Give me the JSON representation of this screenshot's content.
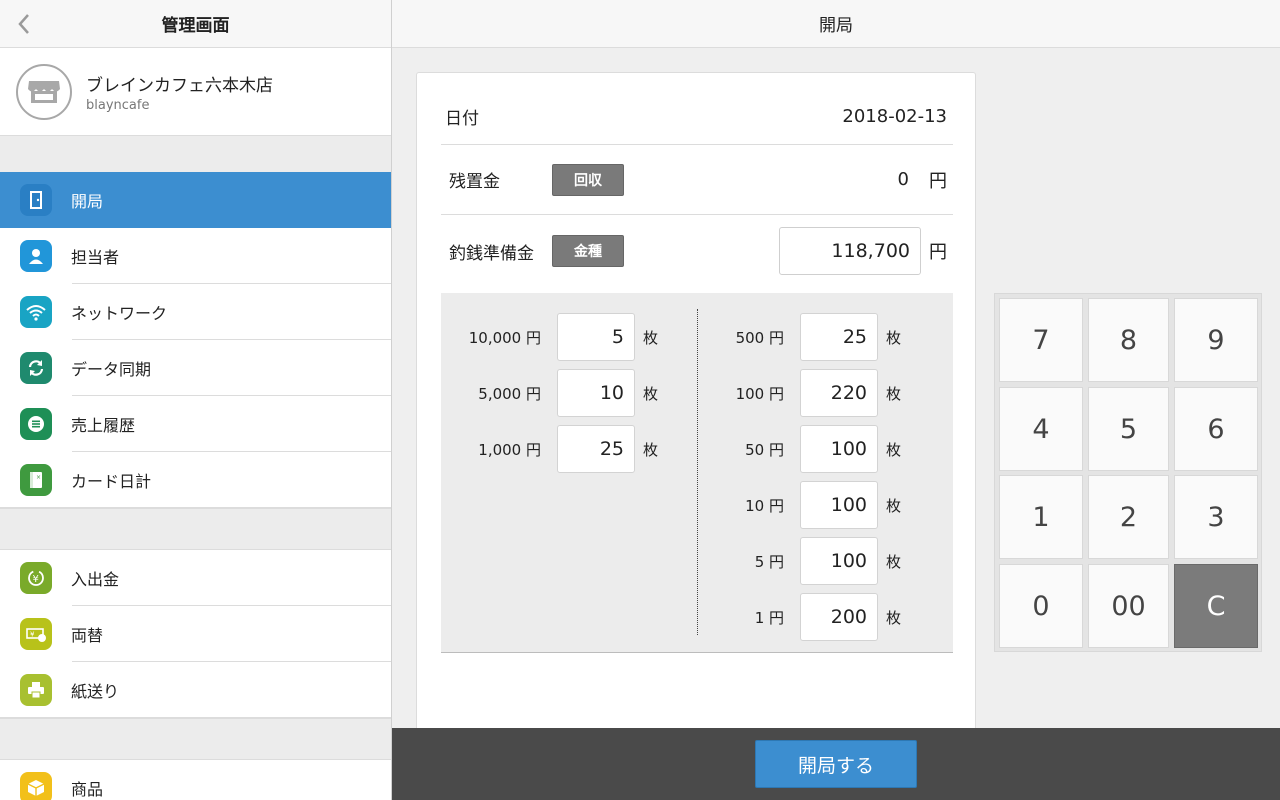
{
  "sidebar": {
    "title": "管理画面",
    "store": {
      "name": "ブレインカフェ六本木店",
      "id": "blayncafe"
    },
    "group1": [
      {
        "label": "開局",
        "icon": "door-icon",
        "color": "#3c8ed0",
        "active": true
      },
      {
        "label": "担当者",
        "icon": "person-icon",
        "color": "#2196d9"
      },
      {
        "label": "ネットワーク",
        "icon": "wifi-icon",
        "color": "#19a4c4"
      },
      {
        "label": "データ同期",
        "icon": "sync-icon",
        "color": "#1f8a6e"
      },
      {
        "label": "売上履歴",
        "icon": "list-icon",
        "color": "#1e8f56"
      },
      {
        "label": "カード日計",
        "icon": "card-icon",
        "color": "#3f9a3f"
      }
    ],
    "group2": [
      {
        "label": "入出金",
        "icon": "yen-cycle-icon",
        "color": "#7aaa2a"
      },
      {
        "label": "両替",
        "icon": "exchange-icon",
        "color": "#b8c21a"
      },
      {
        "label": "紙送り",
        "icon": "printer-icon",
        "color": "#a8c030"
      }
    ],
    "group3": [
      {
        "label": "商品",
        "icon": "box-icon",
        "color": "#f2c01a"
      }
    ]
  },
  "main": {
    "title": "開局",
    "date_label": "日付",
    "date_value": "2018-02-13",
    "residual_label": "残置金",
    "collect_button": "回収",
    "residual_value": "0",
    "yen": "円",
    "change_label": "釣銭準備金",
    "denom_button": "金種",
    "change_value": "118,700",
    "unit": "枚",
    "bills": [
      {
        "label": "10,000 円",
        "count": "5"
      },
      {
        "label": "5,000 円",
        "count": "10"
      },
      {
        "label": "1,000 円",
        "count": "25"
      }
    ],
    "coins": [
      {
        "label": "500 円",
        "count": "25"
      },
      {
        "label": "100 円",
        "count": "220"
      },
      {
        "label": "50 円",
        "count": "100"
      },
      {
        "label": "10 円",
        "count": "100"
      },
      {
        "label": "5 円",
        "count": "100"
      },
      {
        "label": "1 円",
        "count": "200"
      }
    ],
    "keypad": [
      "7",
      "8",
      "9",
      "4",
      "5",
      "6",
      "1",
      "2",
      "3",
      "0",
      "00",
      "C"
    ],
    "open_button": "開局する"
  }
}
